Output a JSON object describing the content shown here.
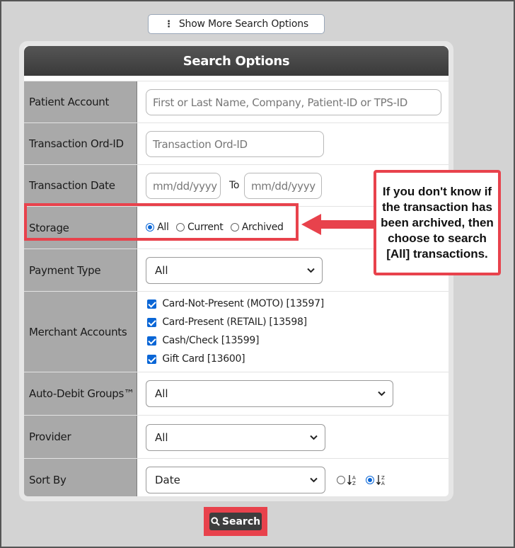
{
  "top_button": {
    "label": "Show More Search Options"
  },
  "panel": {
    "title": "Search Options"
  },
  "rows": {
    "patient_account": {
      "label": "Patient Account",
      "placeholder": "First or Last Name, Company, Patient-ID or TPS-ID"
    },
    "transaction_ord_id": {
      "label": "Transaction Ord-ID",
      "placeholder": "Transaction Ord-ID"
    },
    "transaction_date": {
      "label": "Transaction Date",
      "from_placeholder": "mm/dd/yyyy",
      "to_label": "To",
      "to_placeholder": "mm/dd/yyyy"
    },
    "storage": {
      "label": "Storage",
      "options": [
        "All",
        "Current",
        "Archived"
      ],
      "selected": "All"
    },
    "payment_type": {
      "label": "Payment Type",
      "value": "All"
    },
    "merchant_accounts": {
      "label": "Merchant Accounts",
      "items": [
        "Card-Not-Present (MOTO) [13597]",
        "Card-Present (RETAIL) [13598]",
        "Cash/Check [13599]",
        "Gift Card [13600]"
      ]
    },
    "auto_debit_groups": {
      "label": "Auto-Debit Groups™",
      "value": "All"
    },
    "provider": {
      "label": "Provider",
      "value": "All"
    },
    "sort_by": {
      "label": "Sort By",
      "value": "Date",
      "order_selected": "descending"
    }
  },
  "callout": {
    "text": "If you don't know if the transaction has been archived, then choose to search [All] transactions."
  },
  "search_button": {
    "label": "Search"
  },
  "colors": {
    "accent_red": "#e8424c",
    "checkbox_blue": "#0a66d6",
    "header_dark": "#3a3a3a",
    "label_gray": "#a9a9a9"
  }
}
